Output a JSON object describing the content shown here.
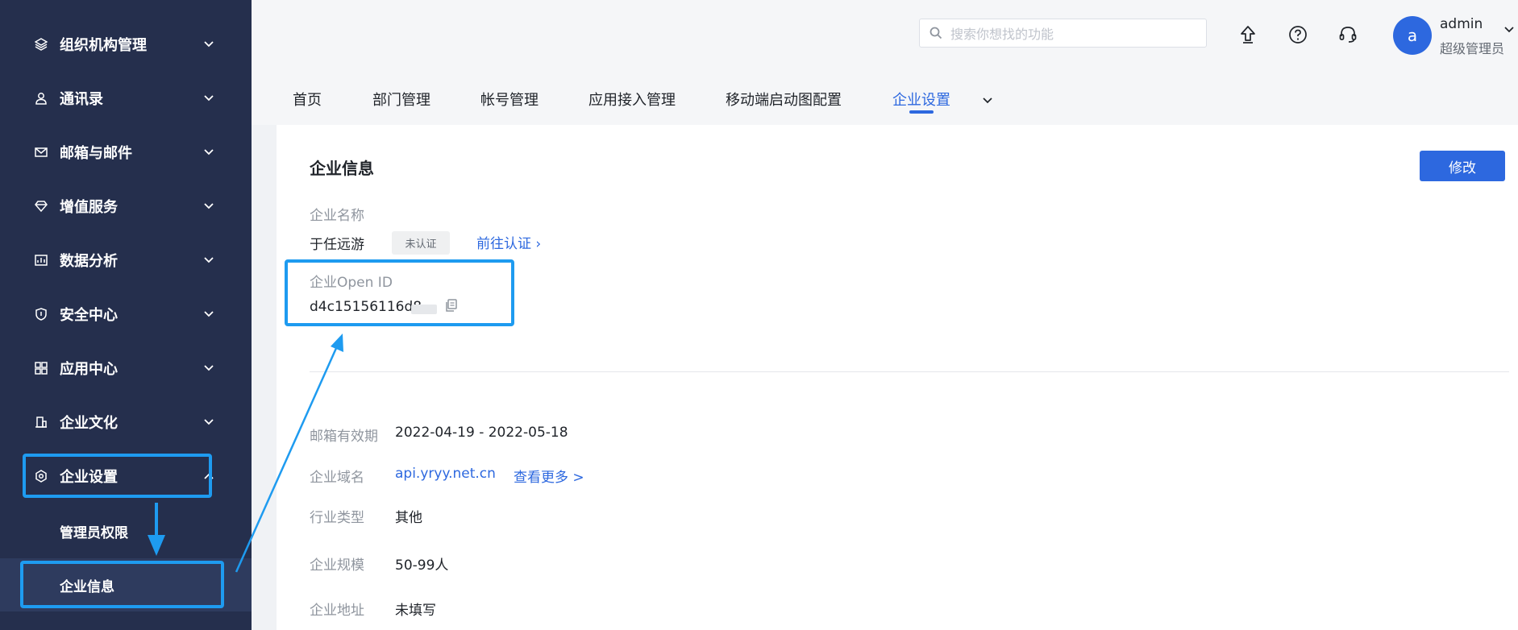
{
  "sidebar": {
    "items": [
      {
        "label": "组织机构管理",
        "icon": "layers-icon"
      },
      {
        "label": "通讯录",
        "icon": "contact-icon"
      },
      {
        "label": "邮箱与邮件",
        "icon": "mail-icon"
      },
      {
        "label": "增值服务",
        "icon": "diamond-icon"
      },
      {
        "label": "数据分析",
        "icon": "chart-icon"
      },
      {
        "label": "安全中心",
        "icon": "shield-icon"
      },
      {
        "label": "应用中心",
        "icon": "grid-icon"
      },
      {
        "label": "企业文化",
        "icon": "building-icon"
      },
      {
        "label": "企业设置",
        "icon": "settings-icon"
      }
    ],
    "sub_items": [
      {
        "label": "管理员权限"
      },
      {
        "label": "企业信息"
      }
    ]
  },
  "header": {
    "search_placeholder": "搜索你想找的功能",
    "user": {
      "avatar_letter": "a",
      "name": "admin",
      "role": "超级管理员"
    }
  },
  "tabs": [
    {
      "label": "首页"
    },
    {
      "label": "部门管理"
    },
    {
      "label": "帐号管理"
    },
    {
      "label": "应用接入管理"
    },
    {
      "label": "移动端启动图配置"
    },
    {
      "label": "企业设置"
    }
  ],
  "content": {
    "title": "企业信息",
    "edit_label": "修改",
    "company_name_label": "企业名称",
    "company_name": "于任远游",
    "cert_badge": "未认证",
    "cert_link": "前往认证 ›",
    "open_id_label": "企业Open ID",
    "open_id_value": "d4c15156116d8",
    "fields": [
      {
        "label": "邮箱有效期",
        "value": "2022-04-19 - 2022-05-18"
      },
      {
        "label": "企业域名",
        "value": "api.yryy.net.cn",
        "link": "查看更多 >"
      },
      {
        "label": "行业类型",
        "value": "其他"
      },
      {
        "label": "企业规模",
        "value": "50-99人"
      },
      {
        "label": "企业地址",
        "value": "未填写"
      }
    ]
  },
  "colors": {
    "sidebar_bg": "#252f4d",
    "accent": "#2d68df",
    "annotation": "#1e9bf0"
  }
}
